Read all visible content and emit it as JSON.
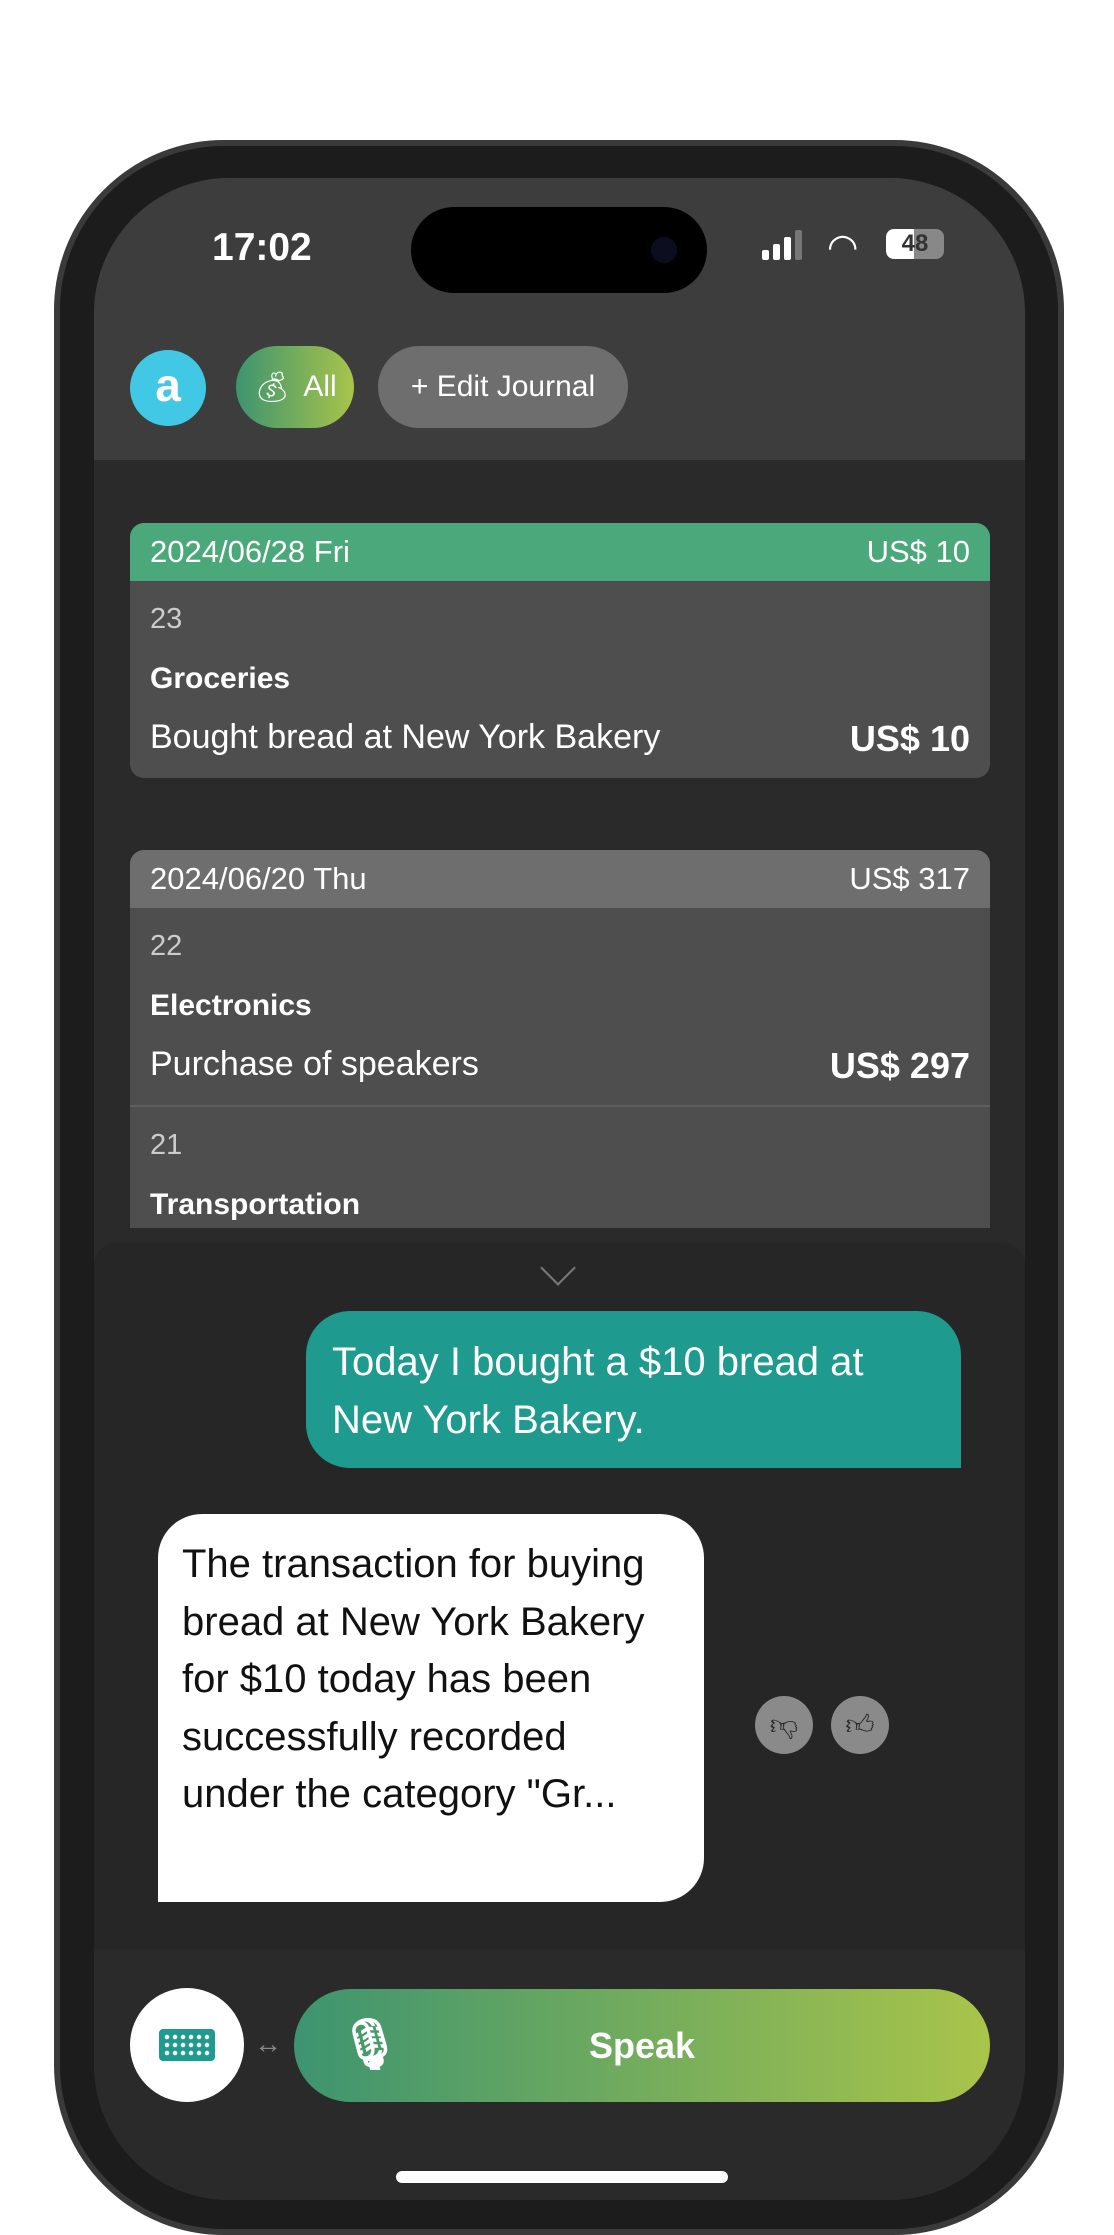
{
  "status": {
    "time": "17:02",
    "battery": "48"
  },
  "header": {
    "avatar_letter": "a",
    "filter_label": "All",
    "filter_icon": "money-bag-icon",
    "edit_label": "+ Edit Journal"
  },
  "journal": [
    {
      "date": "2024/06/28 Fri",
      "total": "US$ 10",
      "header_color": "#4aa87a",
      "entries": [
        {
          "id": "23",
          "category": "Groceries",
          "description": "Bought bread at New York Bakery",
          "amount": "US$ 10"
        }
      ]
    },
    {
      "date": "2024/06/20 Thu",
      "total": "US$ 317",
      "header_color": "#6e6e6e",
      "entries": [
        {
          "id": "22",
          "category": "Electronics",
          "description": "Purchase of speakers",
          "amount": "US$ 297"
        },
        {
          "id": "21",
          "category": "Transportation"
        }
      ]
    }
  ],
  "chat": {
    "user_message": "Today I bought a $10 bread at New York Bakery.",
    "bot_message": "The transaction for buying bread at New York Bakery for $10 today has been successfully recorded under the category \"Gr..."
  },
  "input": {
    "speak_label": "Speak",
    "swap_glyph": "↔"
  },
  "colors": {
    "accent_teal": "#1f9a8e",
    "gradient_start": "#3d9470",
    "gradient_end": "#a9c44a",
    "avatar": "#41c8e4"
  }
}
